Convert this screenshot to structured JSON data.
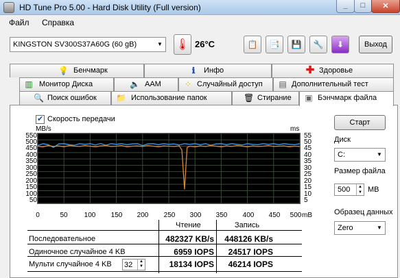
{
  "window": {
    "title": "HD Tune Pro 5.00 - Hard Disk Utility (Full  version)"
  },
  "menu": {
    "items": [
      {
        "label": "Файл"
      },
      {
        "label": "Справка"
      }
    ]
  },
  "toolbar": {
    "drive": "KINGSTON SV300S37A60G    (60 gB)",
    "temperature": "26°C",
    "exit_label": "Выход"
  },
  "tabs": {
    "row1": [
      {
        "label": "Бенчмарк"
      },
      {
        "label": "Инфо"
      },
      {
        "label": "Здоровье"
      }
    ],
    "row2": [
      {
        "label": "Монитор Диска"
      },
      {
        "label": "AAM"
      },
      {
        "label": "Случайный доступ"
      },
      {
        "label": "Дополнительный  тест"
      }
    ],
    "row3": [
      {
        "label": "Поиск ошибок"
      },
      {
        "label": "Использование папок"
      },
      {
        "label": "Стирание"
      },
      {
        "label": "Бэнчмарк файла"
      }
    ]
  },
  "benchmark": {
    "transfer_checkbox": {
      "label": "Скорость передачи",
      "checked": true
    },
    "y_unit_left": "MB/s",
    "y_unit_right": "ms",
    "x_unit": "mB",
    "col_read": "Чтение",
    "col_write": "Запись",
    "rows": [
      {
        "label": "Последовательное",
        "read": "482327 KB/s",
        "write": "448126 KB/s"
      },
      {
        "label": "Одиночное случайное 4 KB",
        "read": "6959 IOPS",
        "write": "24517 IOPS"
      },
      {
        "label": "Мульти случайное 4 KB",
        "read": "18134 IOPS",
        "write": "46214 IOPS"
      }
    ],
    "queue_depth": "32"
  },
  "side": {
    "start_label": "Старт",
    "disk_label": "Диск",
    "disk_value": "C:",
    "file_size_label": "Размер файла",
    "file_size_value": "500",
    "file_size_unit": "MB",
    "pattern_label": "Образец данных",
    "pattern_value": "Zero"
  },
  "chart_data": {
    "type": "line",
    "xlabel": "mB",
    "ylabel": "MB/s",
    "y2label": "ms",
    "xlim": [
      0,
      500
    ],
    "ylim": [
      0,
      550
    ],
    "y2lim": [
      0,
      55
    ],
    "x_ticks": [
      "0",
      "50",
      "100",
      "150",
      "200",
      "250",
      "300",
      "350",
      "400",
      "450",
      "500"
    ],
    "y_ticks": [
      "550",
      "500",
      "450",
      "400",
      "350",
      "300",
      "250",
      "200",
      "150",
      "100",
      "50"
    ],
    "y2_ticks": [
      "55",
      "50",
      "45",
      "40",
      "35",
      "30",
      "25",
      "20",
      "15",
      "10",
      "5"
    ],
    "grid": true,
    "series": [
      {
        "color": "#3d9be8",
        "x": [
          0,
          10,
          20,
          30,
          40,
          50,
          60,
          70,
          80,
          90,
          100,
          110,
          120,
          130,
          140,
          150,
          160,
          170,
          180,
          190,
          200,
          210,
          220,
          230,
          240,
          250,
          260,
          270,
          280,
          290,
          300,
          310,
          320,
          330,
          340,
          350,
          360,
          370,
          380,
          390,
          400,
          410,
          420,
          430,
          440,
          450,
          460,
          470,
          480,
          490,
          500
        ],
        "values": [
          455,
          470,
          462,
          440,
          468,
          470,
          462,
          458,
          470,
          465,
          470,
          460,
          472,
          458,
          470,
          465,
          470,
          462,
          468,
          470,
          455,
          468,
          470,
          462,
          470,
          465,
          468,
          460,
          470,
          465,
          470,
          462,
          470,
          458,
          468,
          470,
          462,
          470,
          465,
          460,
          470,
          465,
          462,
          470,
          465,
          470,
          462,
          470,
          465,
          462,
          470
        ]
      },
      {
        "color": "#e08a2a",
        "x": [
          0,
          10,
          20,
          30,
          40,
          50,
          60,
          70,
          80,
          90,
          100,
          110,
          120,
          130,
          140,
          150,
          160,
          170,
          180,
          190,
          200,
          210,
          220,
          230,
          240,
          250,
          260,
          270,
          275,
          280,
          285,
          290,
          300,
          310,
          320,
          330,
          340,
          350,
          360,
          370,
          380,
          390,
          400,
          410,
          420,
          430,
          440,
          450,
          460,
          470,
          480,
          490,
          500
        ],
        "values": [
          450,
          445,
          455,
          448,
          452,
          446,
          455,
          450,
          448,
          455,
          450,
          446,
          452,
          455,
          448,
          450,
          455,
          446,
          450,
          452,
          448,
          455,
          450,
          446,
          452,
          450,
          448,
          452,
          420,
          110,
          440,
          450,
          446,
          452,
          448,
          455,
          450,
          446,
          452,
          448,
          455,
          450,
          446,
          452,
          448,
          450,
          455,
          448,
          450,
          452,
          446,
          450,
          448
        ]
      }
    ]
  }
}
